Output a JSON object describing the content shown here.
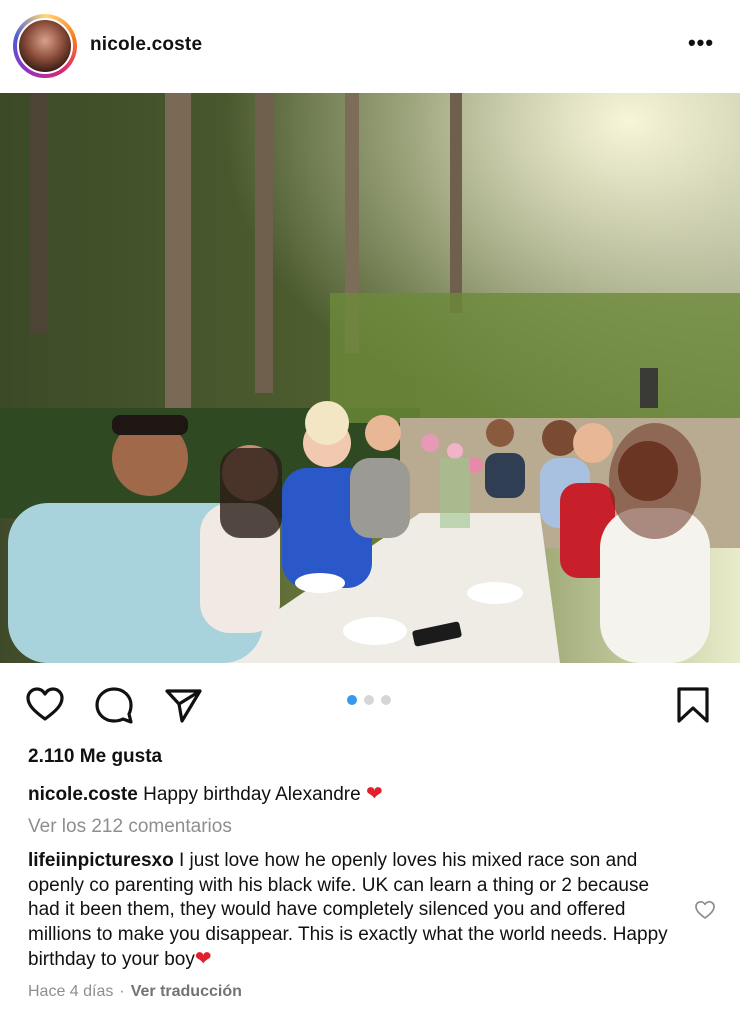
{
  "post": {
    "username": "nicole.coste",
    "more_label": "•••",
    "photo_alt": "Group photo at outdoor dining table",
    "likes": "2.110 Me gusta",
    "caption": {
      "username": "nicole.coste",
      "text": "Happy birthday Alexandre",
      "emoji": "❤"
    },
    "view_comments": "Ver los 212 comentarios",
    "carousel": {
      "count": 3,
      "active": 1,
      "active_color": "#3897f0"
    },
    "comment": {
      "username": "lifeiinpicturesxo",
      "text": "I just love how he openly loves his mixed race son and openly co parenting with his black wife. UK can learn a thing or 2 because had it been them, they would have completely silenced you and offered millions to make you disappear. This is exactly what the world needs. Happy birthday to your boy",
      "emoji": "❤"
    },
    "meta": {
      "time": "Hace 4 días",
      "separator": "·",
      "translate": "Ver traducción"
    }
  },
  "icons": [
    "heart-icon",
    "comment-icon",
    "share-icon",
    "bookmark-icon",
    "more-icon",
    "heart-outline-icon"
  ],
  "colors": {
    "text": "#111111",
    "muted": "#8e8e8e",
    "accent": "#3897f0",
    "heart": "#e0202a"
  }
}
